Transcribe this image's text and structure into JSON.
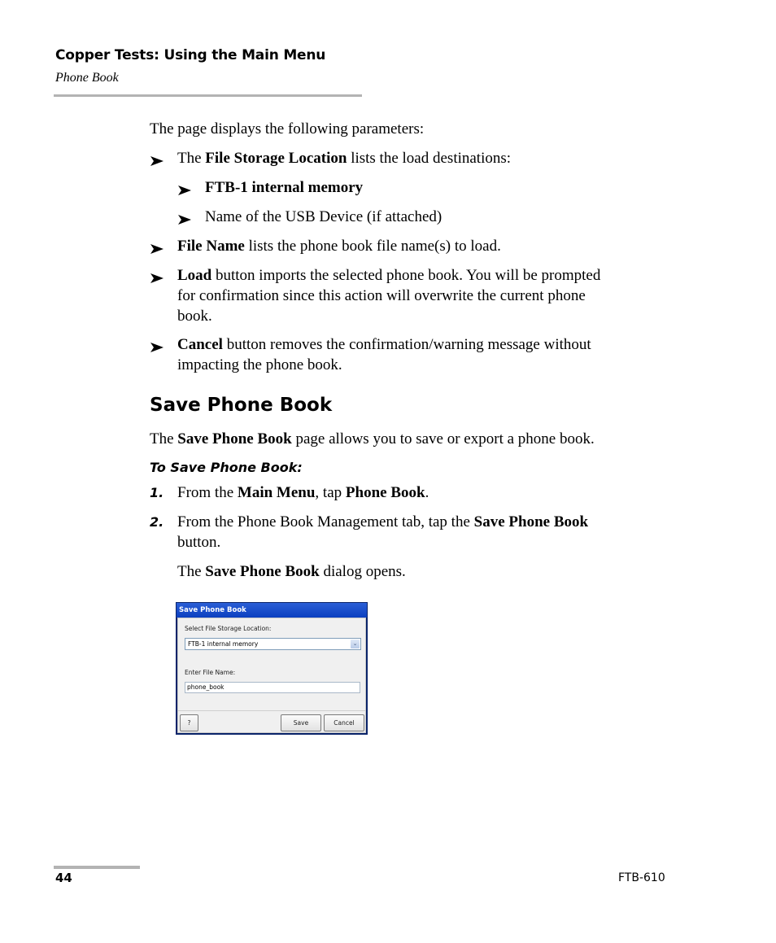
{
  "header": {
    "chapter": "Copper Tests: Using the Main Menu",
    "section": "Phone Book"
  },
  "intro": "The page displays the following parameters:",
  "parameters": [
    {
      "pre": "The ",
      "bold": "File Storage Location",
      "post": " lists the load destinations:"
    },
    {
      "bold": "FTB-1 internal memory"
    },
    {
      "text": "Name of the USB Device (if attached)"
    },
    {
      "bold": "File Name",
      "post": " lists the phone book file name(s) to load."
    },
    {
      "bold": "Load",
      "post_line1": " button imports the selected phone book. You will be prompted",
      "line2": "for confirmation since this action will overwrite the current phone",
      "line3": "book."
    },
    {
      "bold": "Cancel",
      "post_line1": " button removes the confirmation/warning message without",
      "line2": "impacting the phone book."
    }
  ],
  "save_section": {
    "heading": "Save Phone Book",
    "desc_pre": "The ",
    "desc_bold": "Save Phone Book",
    "desc_post": " page allows you to save or export a phone book.",
    "procedure_title": "To Save Phone Book:",
    "steps": [
      {
        "num": "1.",
        "pre": "From the ",
        "bold1": "Main Menu",
        "mid": ", tap ",
        "bold2": "Phone Book",
        "post": "."
      },
      {
        "num": "2.",
        "pre": "From the Phone Book Management tab, tap the ",
        "bold": "Save Phone Book",
        "line2": "button."
      }
    ],
    "result_pre": "The ",
    "result_bold": "Save Phone Book",
    "result_post": " dialog opens."
  },
  "dialog": {
    "title": "Save Phone Book",
    "storage_label": "Select File Storage Location:",
    "storage_value": "FTB-1 internal memory",
    "dropdown_arrow": "chevron-down",
    "filename_label": "Enter File Name:",
    "filename_value": "phone_book",
    "help_label": "?",
    "save_label": "Save",
    "cancel_label": "Cancel"
  },
  "footer": {
    "page_number": "44",
    "model": "FTB-610"
  }
}
